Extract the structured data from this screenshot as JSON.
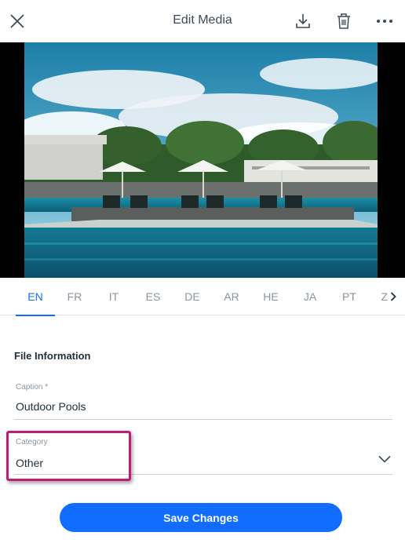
{
  "header": {
    "title": "Edit Media",
    "icons": [
      "close-icon",
      "download-icon",
      "trash-icon",
      "more-icon"
    ]
  },
  "media": {
    "description_icon": "pool-photo"
  },
  "language_tabs": {
    "items": [
      "EN",
      "FR",
      "IT",
      "ES",
      "DE",
      "AR",
      "HE",
      "JA",
      "PT",
      "Z"
    ],
    "active": "EN",
    "next_icon": "chevron-right-icon"
  },
  "file_info": {
    "section_title": "File Information",
    "caption_label": "Caption *",
    "caption_value": "Outdoor Pools",
    "category_label": "Category",
    "category_value": "Other"
  },
  "actions": {
    "save_label": "Save Changes"
  },
  "colors": {
    "accent": "#116dff",
    "highlight": "#c21c74"
  }
}
